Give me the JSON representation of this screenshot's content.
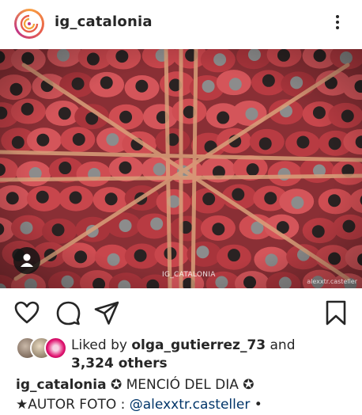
{
  "header": {
    "username": "ig_catalonia",
    "avatar_icon": "ig-catalonia-logo",
    "more_icon": "more-vertical-icon"
  },
  "post": {
    "image_alt": "Aerial view of castellers in red shirts forming the base of a human tower",
    "watermark": "IG_CATALONIA",
    "photo_credit": "alexxtr.casteller",
    "user_tag_icon": "user-tag-icon"
  },
  "actions": {
    "like_icon": "heart-icon",
    "comment_icon": "comment-icon",
    "share_icon": "share-icon",
    "save_icon": "bookmark-icon"
  },
  "likes": {
    "prefix": "Liked by ",
    "user": "olga_gutierrez_73",
    "connector": " and",
    "others": "3,324 others"
  },
  "caption": {
    "username": "ig_catalonia",
    "line1_text": " ✪ MENCIÓ DEL DIA ✪",
    "line2_prefix": "★AUTOR FOTO : ",
    "line2_mention": "@alexxtr.casteller",
    "line2_suffix": " •"
  },
  "colors": {
    "text": "#262626",
    "mention": "#003569",
    "shirt_red": "#c8464c"
  }
}
